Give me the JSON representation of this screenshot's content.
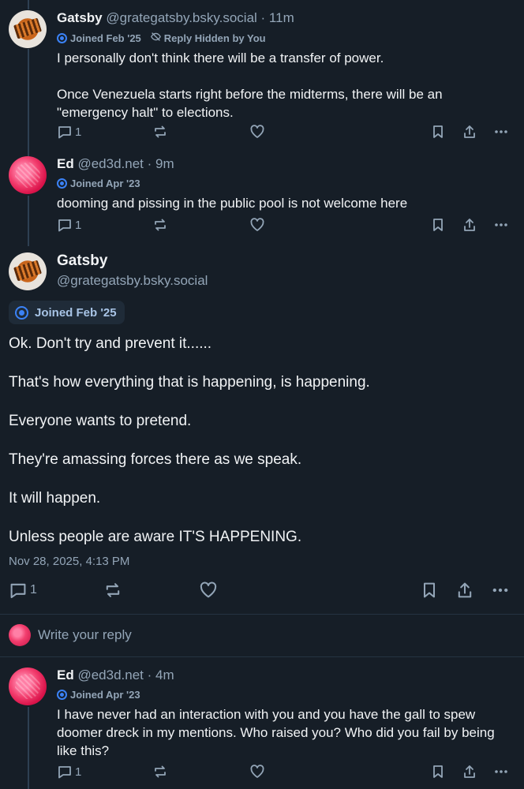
{
  "posts": [
    {
      "name": "Gatsby",
      "handle": "@grategatsby.bsky.social",
      "time": "· 11m",
      "joined": "Joined Feb '25",
      "hidden": "Reply Hidden by You",
      "paragraphs": [
        "I personally don't think there will be a transfer of power.",
        "Once Venezuela starts right before the midterms, there will be an \"emergency halt\" to elections."
      ],
      "reply_count": "1"
    },
    {
      "name": "Ed",
      "handle": "@ed3d.net",
      "time": "· 9m",
      "joined": "Joined Apr '23",
      "paragraphs": [
        "dooming and pissing in the public pool is not welcome here"
      ],
      "reply_count": "1"
    }
  ],
  "main_post": {
    "name": "Gatsby",
    "handle": "@grategatsby.bsky.social",
    "joined": "Joined Feb '25",
    "paragraphs": [
      "Ok. Don't try and prevent it......",
      "That's how everything that is happening, is happening.",
      "Everyone wants to pretend.",
      "They're amassing forces there as we speak.",
      "It will happen.",
      "Unless people are aware IT'S HAPPENING."
    ],
    "timestamp": "Nov 28, 2025, 4:13 PM",
    "reply_count": "1"
  },
  "reply_box": {
    "placeholder": "Write your reply"
  },
  "reply": {
    "name": "Ed",
    "handle": "@ed3d.net",
    "time": "· 4m",
    "joined": "Joined Apr '23",
    "text": "I have never had an interaction with you and you have the gall to spew doomer dreck in my mentions. Who raised you? Who did you fail by being like this?",
    "reply_count": "1"
  },
  "colors": {
    "background": "#161e27",
    "muted": "#93a5b7",
    "accent": "#3b82f6",
    "thread_line": "#2e4052"
  },
  "icons": [
    "reply-icon",
    "repost-icon",
    "like-icon",
    "bookmark-icon",
    "share-icon",
    "more-icon",
    "verified-badge-icon",
    "eye-slash-icon"
  ]
}
